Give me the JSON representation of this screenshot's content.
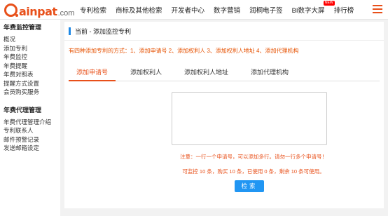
{
  "brand": {
    "name": "ainpat",
    "domain": ".com",
    "accent": "#e8501a"
  },
  "nav": {
    "items": [
      "专利检索",
      "商标及其他检索",
      "开发者中心",
      "数字营销",
      "润桐电子签",
      "BI数字大屏",
      "排行榜"
    ],
    "new_badge": "NEW"
  },
  "sidebar": {
    "section1_title": "年费监控管理",
    "section1_items": [
      "概况",
      "添加专利",
      "年费监控",
      "年费提醒",
      "年费对照表",
      "提醒方式设置",
      "会员购买服务"
    ],
    "section2_title": "年费代理管理",
    "section2_items": [
      "年费代理管理介绍",
      "专利联系人",
      "邮件预警记录",
      "发送邮箱设定"
    ]
  },
  "main": {
    "breadcrumb": "当前 - 添加监控专利",
    "notice": "有四种添加专利的方式：1、添加申请号 2、添加权利人 3、添加权利人地址 4、添加代理机构",
    "tabs": [
      "添加申请号",
      "添加权利人",
      "添加权利人地址",
      "添加代理机构"
    ],
    "active_tab": "添加申请号",
    "textarea_value": "",
    "hint_line1": "注意：一行一个申请号，可以添加多行。请勿一行多个申请号！",
    "hint_line2": "可监控 10 条，购买 10 条，已使用 0 条，剩余 10 条可使用。",
    "search_label": "检索"
  },
  "colors": {
    "accent": "#e8501a",
    "button": "#2196f3",
    "crumb_bar": "#1e88e5"
  }
}
